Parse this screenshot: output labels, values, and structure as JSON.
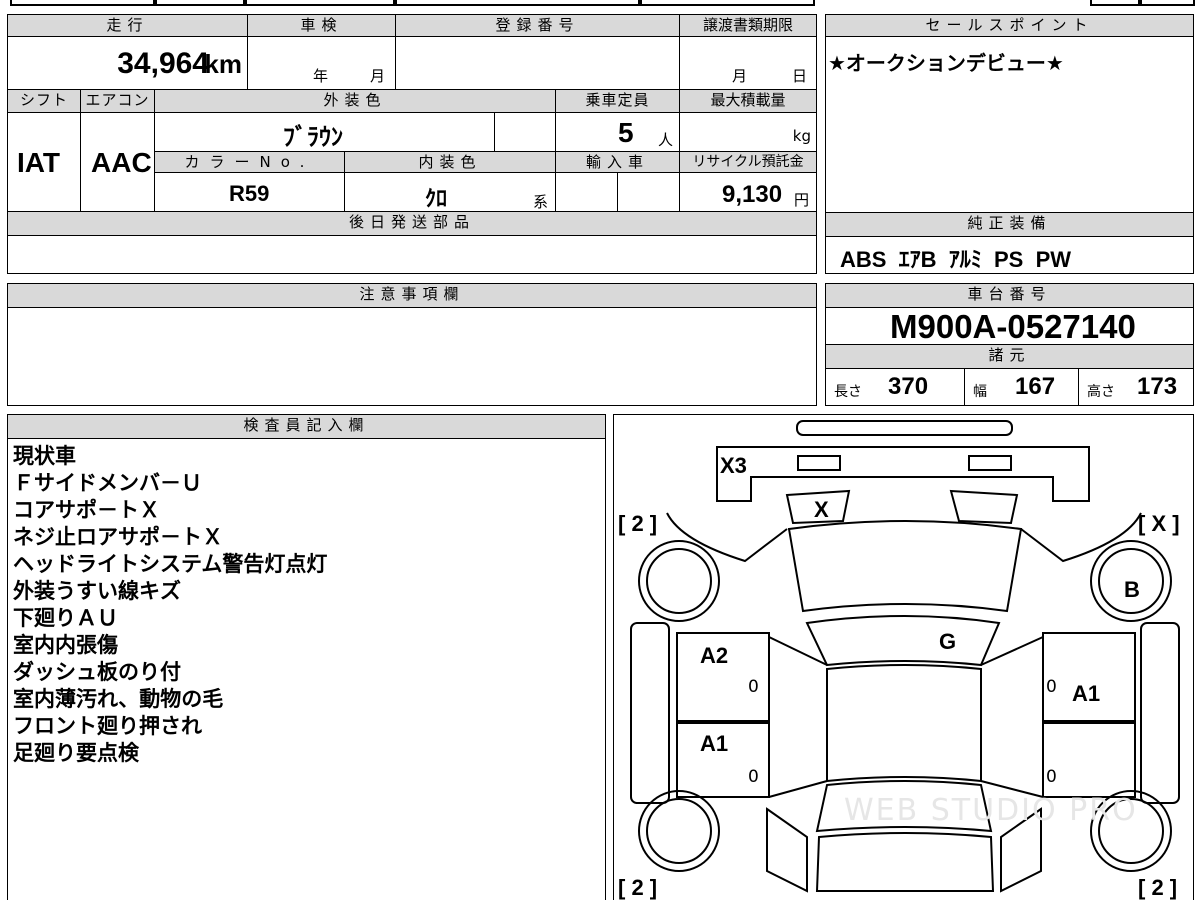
{
  "info": {
    "mileage_label": "走行",
    "mileage_value": "34,964",
    "mileage_unit": "km",
    "inspection_label": "車検",
    "inspection_year": "年",
    "inspection_month": "月",
    "reg_label": "登録番号",
    "transfer_label": "譲渡書類期限",
    "transfer_month": "月",
    "transfer_day": "日",
    "shift_label": "シフト",
    "shift_value": "IAT",
    "ac_label": "エアコン",
    "ac_value": "AAC",
    "exterior_label": "外装色",
    "exterior_value": "ﾌﾞﾗｳﾝ",
    "capacity_label": "乗車定員",
    "capacity_value": "5",
    "capacity_unit": "人",
    "load_label": "最大積載量",
    "load_unit": "kg",
    "color_no_label": "カラーNo.",
    "color_no_value": "R59",
    "interior_label": "内装色",
    "interior_value": "ｸﾛ",
    "interior_suffix": "系",
    "import_label": "輸入車",
    "recycle_label": "リサイクル預託金",
    "recycle_value": "9,130",
    "recycle_unit": "円",
    "later_parts_label": "後日発送部品"
  },
  "sales": {
    "label": "セールスポイント",
    "text": "★オークションデビュー★",
    "equip_label": "純正装備",
    "equip_value": "ABS  ｴｱB  ｱﾙﾐ  PS  PW"
  },
  "notes": {
    "label": "注意事項欄"
  },
  "chassis": {
    "label": "車台番号",
    "value": "M900A-0527140",
    "spec_label": "諸元",
    "length_label": "長さ",
    "length_value": "370",
    "width_label": "幅",
    "width_value": "167",
    "height_label": "高さ",
    "height_value": "173"
  },
  "inspector": {
    "label": "検査員記入欄",
    "lines": [
      "現状車",
      "Ｆサイドメンバ－Ｕ",
      "コアサポ－トＸ",
      "ネジ止ロアサポ－トＸ",
      "ヘッドライトシステム警告灯点灯",
      "外装うすい線キズ",
      "下廻りＡＵ",
      "室内内張傷",
      "ダッシュ板のり付",
      "室内薄汚れ、動物の毛",
      "フロント廻り押され",
      "足廻り要点検"
    ]
  },
  "diagram": {
    "marks": {
      "front_bumper": "X3",
      "grille": "X",
      "windshield": "G",
      "front_left_fender": "[ 2 ]",
      "front_right_fender": "[ X ]",
      "right_front_wheel": "B",
      "left_front_door": "A2",
      "right_front_door": "A1",
      "left_rear_door": "A1",
      "rear_left": "[ 2 ]",
      "rear_right": "[ 2 ]",
      "door_zero_1": "0",
      "door_zero_2": "0",
      "door_zero_3": "0",
      "door_zero_4": "0"
    },
    "watermark": "WEB STUDIO PRO"
  }
}
